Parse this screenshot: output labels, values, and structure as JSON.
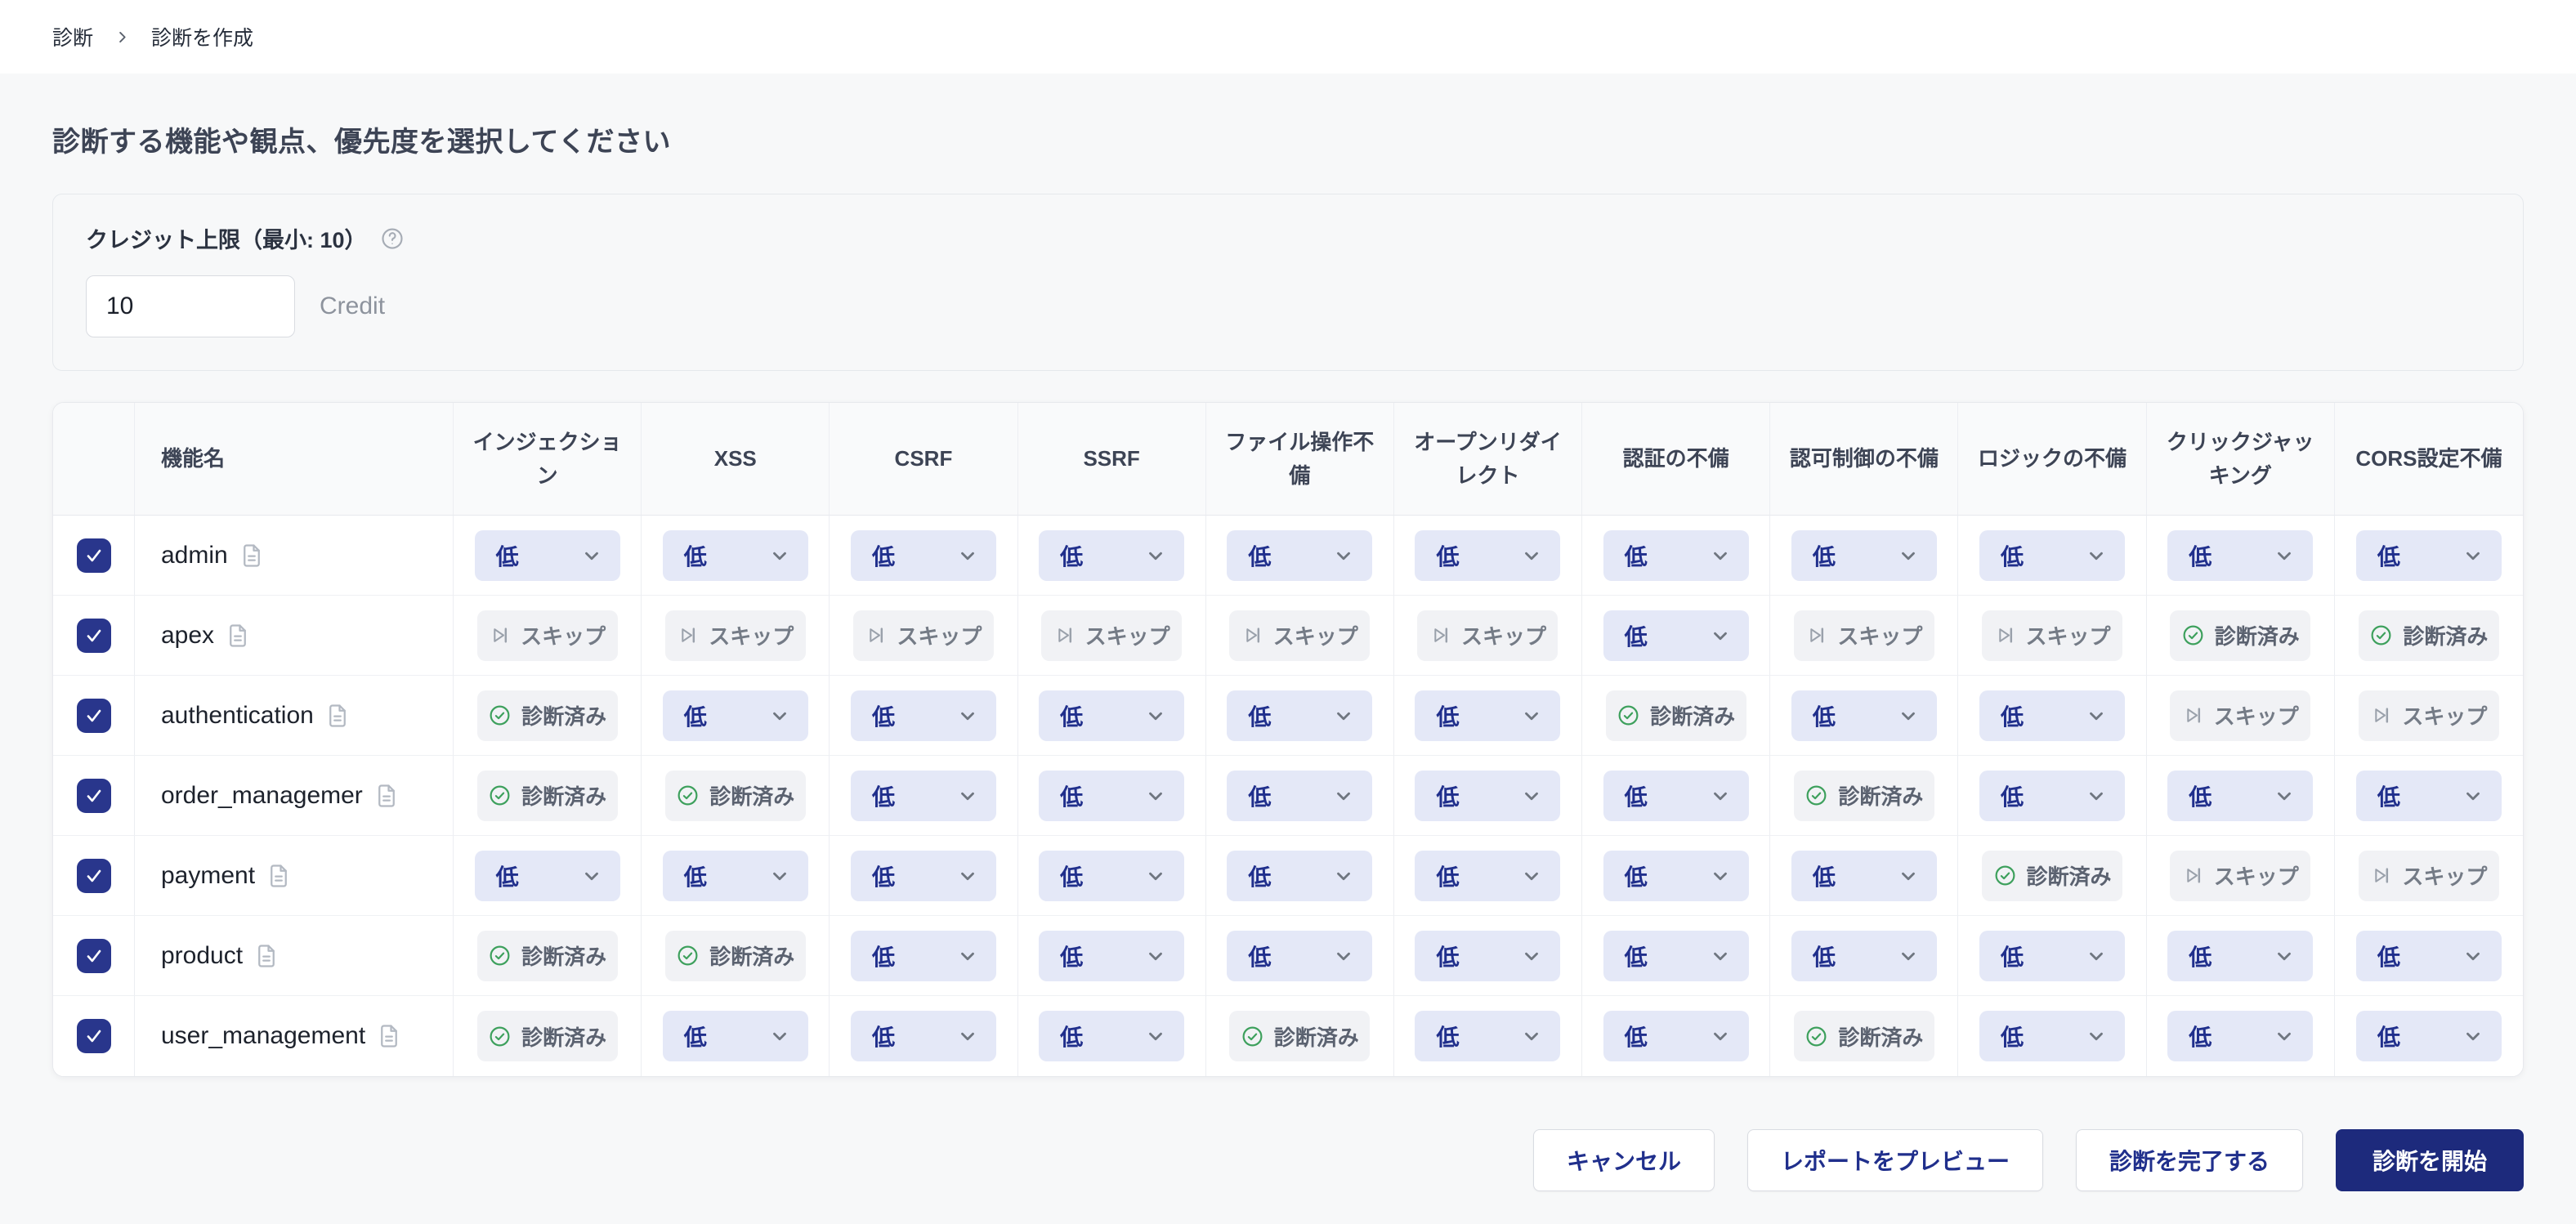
{
  "breadcrumb": {
    "section": "診断",
    "current": "診断を作成"
  },
  "page": {
    "heading": "診断する機能や観点、優先度を選択してください"
  },
  "credit": {
    "label": "クレジット上限（最小: 10）",
    "value": "10",
    "unit": "Credit"
  },
  "table": {
    "headers": {
      "name": "機能名",
      "columns": [
        "インジェクション",
        "XSS",
        "CSRF",
        "SSRF",
        "ファイル操作不備",
        "オープンリダイレクト",
        "認証の不備",
        "認可制御の不備",
        "ロジックの不備",
        "クリックジャッキング",
        "CORS設定不備"
      ]
    },
    "states": {
      "low": "低",
      "skip": "スキップ",
      "done": "診断済み"
    },
    "rows": [
      {
        "name": "admin",
        "checked": true,
        "cells": [
          "low",
          "low",
          "low",
          "low",
          "low",
          "low",
          "low",
          "low",
          "low",
          "low",
          "low"
        ]
      },
      {
        "name": "apex",
        "checked": true,
        "cells": [
          "skip",
          "skip",
          "skip",
          "skip",
          "skip",
          "skip",
          "low",
          "skip",
          "skip",
          "done",
          "done"
        ]
      },
      {
        "name": "authentication",
        "checked": true,
        "cells": [
          "done",
          "low",
          "low",
          "low",
          "low",
          "low",
          "done",
          "low",
          "low",
          "skip",
          "skip"
        ]
      },
      {
        "name": "order_managemer",
        "checked": true,
        "cells": [
          "done",
          "done",
          "low",
          "low",
          "low",
          "low",
          "low",
          "done",
          "low",
          "low",
          "low"
        ]
      },
      {
        "name": "payment",
        "checked": true,
        "cells": [
          "low",
          "low",
          "low",
          "low",
          "low",
          "low",
          "low",
          "low",
          "done",
          "skip",
          "skip"
        ]
      },
      {
        "name": "product",
        "checked": true,
        "cells": [
          "done",
          "done",
          "low",
          "low",
          "low",
          "low",
          "low",
          "low",
          "low",
          "low",
          "low"
        ]
      },
      {
        "name": "user_management",
        "checked": true,
        "cells": [
          "done",
          "low",
          "low",
          "low",
          "done",
          "low",
          "low",
          "done",
          "low",
          "low",
          "low"
        ]
      }
    ]
  },
  "footer": {
    "buttons": [
      {
        "label": "キャンセル",
        "variant": "outline"
      },
      {
        "label": "レポートをプレビュー",
        "variant": "outline"
      },
      {
        "label": "診断を完了する",
        "variant": "outline"
      },
      {
        "label": "診断を開始",
        "variant": "primary"
      }
    ]
  },
  "icons": {
    "breadcrumb_separator": "chevron-right",
    "help": "question-circle",
    "file": "file-text",
    "dropdown": "chevron-down",
    "skip": "skip-forward",
    "done": "check-circle",
    "checkbox_check": "check"
  },
  "colors": {
    "page_background": "#f7f8f9",
    "accent_navy": "#202f8c",
    "primary_button": "#1d2a7c",
    "checkbox": "#29368c",
    "dropdown_bg": "#e4e8f7",
    "chip_gray_bg": "#f1f2f5",
    "done_green": "#3da05c",
    "header_bg": "#f9fafb"
  }
}
